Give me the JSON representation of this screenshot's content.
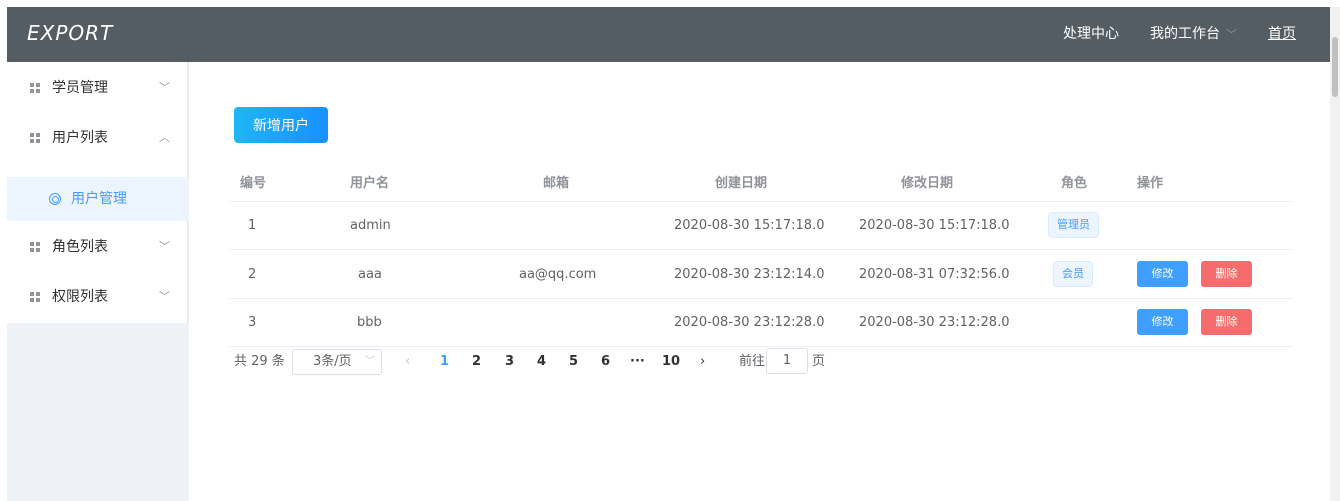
{
  "header": {
    "logo": "EXPORT",
    "nav": {
      "processing": "处理中心",
      "workbench": "我的工作台",
      "home": "首页"
    }
  },
  "sidebar": {
    "items": [
      {
        "label": "学员管理",
        "expanded": false
      },
      {
        "label": "用户列表",
        "expanded": true
      },
      {
        "label": "用户管理",
        "active": true
      },
      {
        "label": "角色列表",
        "expanded": false
      },
      {
        "label": "权限列表",
        "expanded": false
      }
    ]
  },
  "toolbar": {
    "add_label": "新增用户"
  },
  "table": {
    "headers": [
      "编号",
      "用户名",
      "邮箱",
      "创建日期",
      "修改日期",
      "角色",
      "操作"
    ],
    "rows": [
      {
        "id": "1",
        "username": "admin",
        "email": "",
        "created": "2020-08-30 15:17:18.0",
        "modified": "2020-08-30 15:17:18.0",
        "role": "管理员",
        "edit": "",
        "delete": ""
      },
      {
        "id": "2",
        "username": "aaa",
        "email": "aa@qq.com",
        "created": "2020-08-30 23:12:14.0",
        "modified": "2020-08-31 07:32:56.0",
        "role": "会员",
        "edit": "修改",
        "delete": "删除"
      },
      {
        "id": "3",
        "username": "bbb",
        "email": "",
        "created": "2020-08-30 23:12:28.0",
        "modified": "2020-08-30 23:12:28.0",
        "role": "",
        "edit": "修改",
        "delete": "删除"
      }
    ]
  },
  "pagination": {
    "total": "共 29 条",
    "page_size": "3条/页",
    "pages": [
      "1",
      "2",
      "3",
      "4",
      "5",
      "6",
      "···",
      "10"
    ],
    "current": "1",
    "goto_prefix": "前往",
    "goto_value": "1",
    "goto_suffix": "页"
  },
  "colors": {
    "topbar": "#545c64",
    "accent": "#409eff",
    "danger": "#f56c6c"
  }
}
